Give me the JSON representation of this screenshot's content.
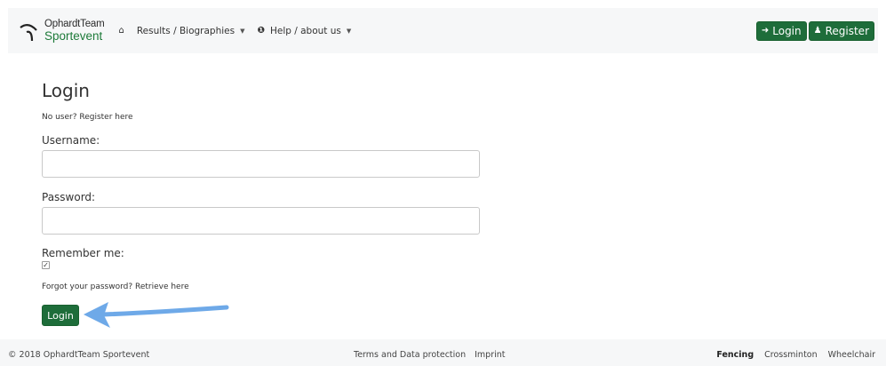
{
  "brand": {
    "top": "OphardtTeam",
    "bottom": "Sportevent",
    "logo_icon": "ophardt-logo-icon"
  },
  "nav": {
    "items": [
      {
        "icon": "home-icon",
        "glyph": "⌂",
        "label": ""
      },
      {
        "label": "Results / Biographies",
        "has_caret": true
      },
      {
        "icon": "info-circle-icon",
        "glyph": "ⓘ",
        "label": "Help / about us",
        "has_caret": true
      }
    ],
    "login_label": "Login",
    "register_label": "Register"
  },
  "main": {
    "title": "Login",
    "register_text": "No user? Register here",
    "username_label": "Username:",
    "username_value": "",
    "password_label": "Password:",
    "password_value": "",
    "remember_label": "Remember me:",
    "remember_checked": true,
    "forgot_text": "Forgot your password? Retrieve here",
    "login_button": "Login"
  },
  "footer": {
    "copyright": "© 2018 OphardtTeam Sportevent",
    "terms": "Terms and Data protection",
    "imprint": "Imprint",
    "sports": [
      "Fencing",
      "Crossminton",
      "Wheelchair"
    ],
    "active_sport": "Fencing"
  },
  "colors": {
    "primary": "#1e6d3a",
    "brand_green": "#1d7a39",
    "annotation_arrow": "#6ea9e8"
  }
}
